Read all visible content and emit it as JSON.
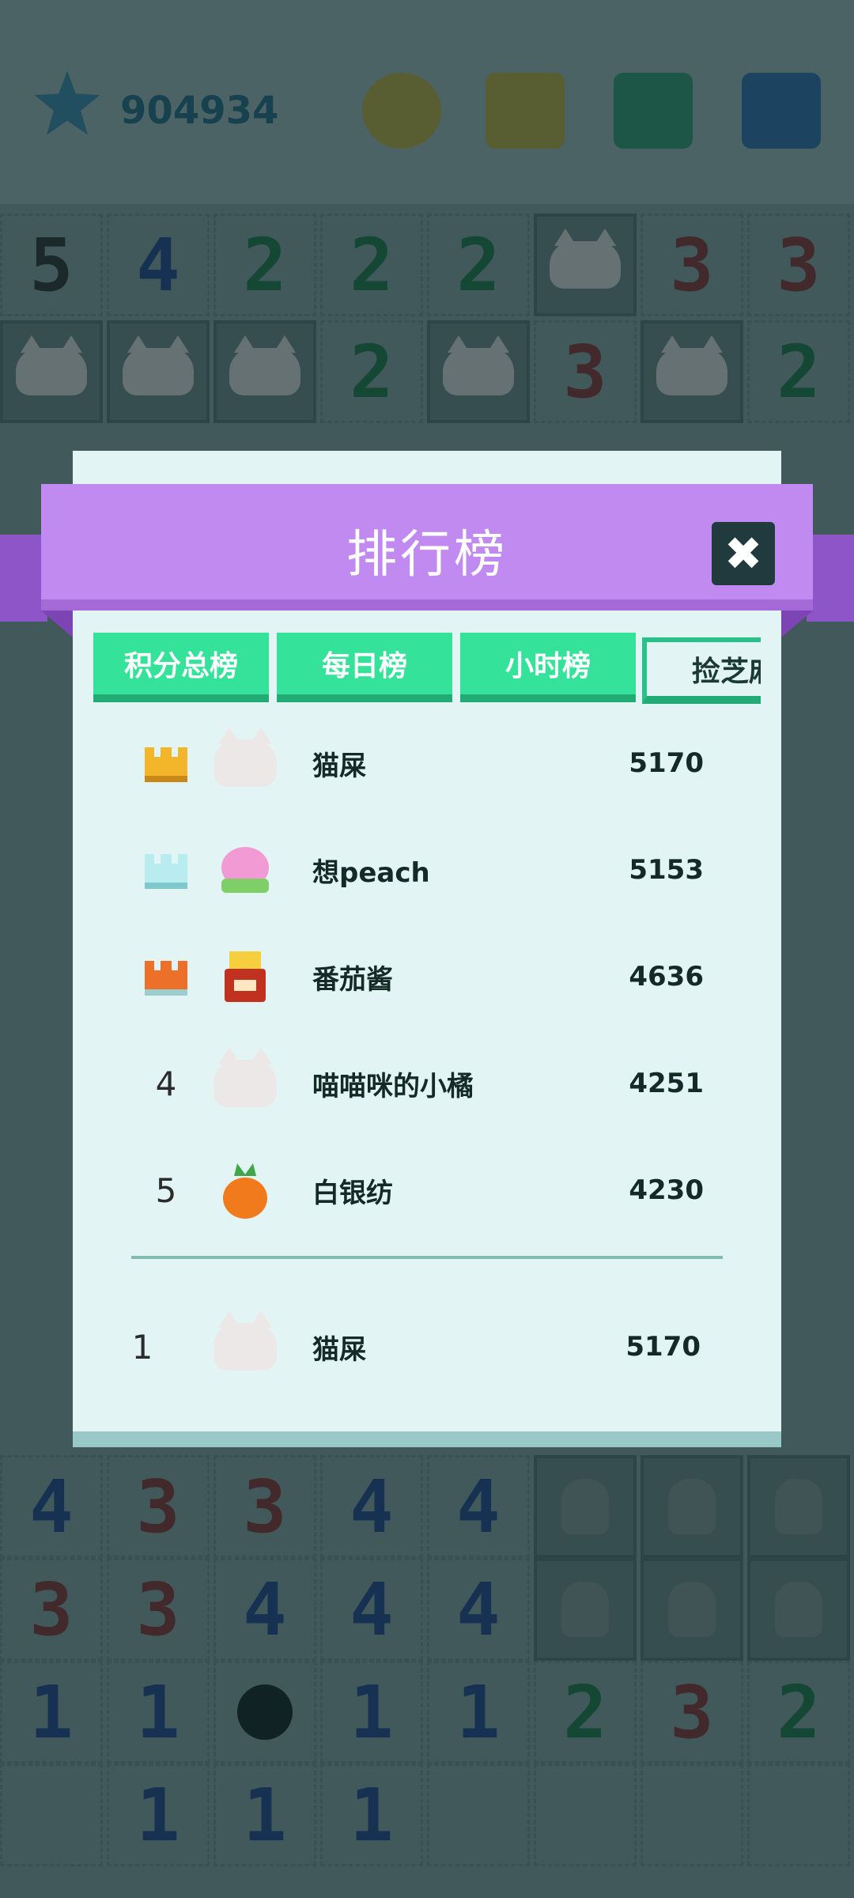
{
  "game": {
    "coins": "904934",
    "board_rows": [
      [
        "5",
        "4",
        "2",
        "2",
        "2",
        "cat",
        "3",
        "3"
      ],
      [
        "cat",
        "cat",
        "cat",
        "2",
        "cat",
        "3",
        "cat",
        "2"
      ],
      [
        "4",
        "3",
        "3",
        "4",
        "4",
        "bunny",
        "bunny",
        "bunny"
      ],
      [
        "3",
        "3",
        "4",
        "4",
        "4",
        "bunny",
        "bunny",
        "bunny"
      ],
      [
        "1",
        "1",
        "mine",
        "1",
        "1",
        "2",
        "3",
        "2"
      ],
      [
        "",
        "1",
        "1",
        "1",
        "",
        "",
        "",
        ""
      ]
    ]
  },
  "modal": {
    "title": "排行榜",
    "close_label": "✖",
    "tabs": [
      "积分总榜",
      "每日榜",
      "小时榜",
      "捡芝麻"
    ],
    "active_tab": "捡芝麻",
    "entries": [
      {
        "rank": "",
        "medal": "gold",
        "avatar": "cat-avatar",
        "name": "猫屎",
        "score": "5170"
      },
      {
        "rank": "",
        "medal": "silver",
        "avatar": "peach-avatar",
        "name": "想peach",
        "score": "5153"
      },
      {
        "rank": "",
        "medal": "bronze",
        "avatar": "fries-avatar",
        "name": "番茄酱",
        "score": "4636"
      },
      {
        "rank": "4",
        "medal": "",
        "avatar": "cat-avatar",
        "name": "喵喵咪的小橘",
        "score": "4251"
      },
      {
        "rank": "5",
        "medal": "",
        "avatar": "carrot-avatar",
        "name": "白银纺",
        "score": "4230"
      }
    ],
    "me": {
      "rank": "1",
      "avatar": "cat-avatar",
      "name": "猫屎",
      "score": "5170"
    }
  }
}
